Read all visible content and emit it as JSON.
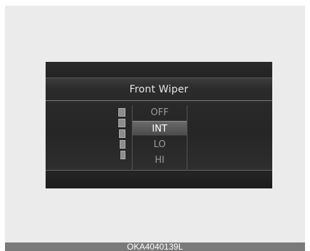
{
  "display": {
    "title": "Front Wiper",
    "options": [
      "OFF",
      "INT",
      "LO",
      "HI"
    ],
    "selected_index": 1,
    "selected_label": "INT",
    "speed_levels": 5
  },
  "caption": "OKA4040139L",
  "colors": {
    "background": "#ebebeb",
    "screen": "#1e1e1e",
    "selected_row": "#5c5c5c",
    "caption_bar": "#7a7a7a"
  }
}
